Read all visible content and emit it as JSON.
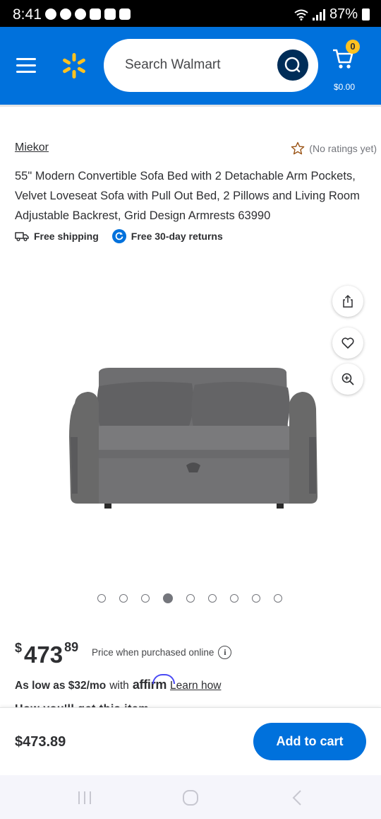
{
  "status_bar": {
    "time": "8:41",
    "battery": "87%"
  },
  "header": {
    "search_placeholder": "Search Walmart",
    "cart_count": "0",
    "cart_total": "$0.00",
    "colors": {
      "brand_blue": "#0071dc",
      "spark_yellow": "#ffc220",
      "search_button": "#002d58"
    }
  },
  "product": {
    "brand": "Miekor",
    "rating_text": "(No ratings yet)",
    "title": "55\" Modern Convertible Sofa Bed with 2 Detachable Arm Pockets, Velvet Loveseat Sofa with Pull Out Bed, 2 Pillows and Living Room Adjustable Backrest, Grid Design Armrests 63990",
    "free_shipping": "Free shipping",
    "free_returns": "Free 30-day returns",
    "image_count": 9,
    "active_image_index": 3,
    "icons": [
      "share-icon",
      "heart-icon",
      "zoom-in-icon"
    ]
  },
  "price": {
    "currency": "$",
    "whole": "473",
    "cents": "89",
    "note": "Price when purchased online",
    "info": "i"
  },
  "financing": {
    "as_low_as": "As low as $32/mo",
    "with": "with",
    "provider": "affirm",
    "learn_how": "Learn how"
  },
  "truncated_line": "How you'll get this item",
  "sticky_bar": {
    "price": "$473.89",
    "add_to_cart": "Add to cart"
  }
}
